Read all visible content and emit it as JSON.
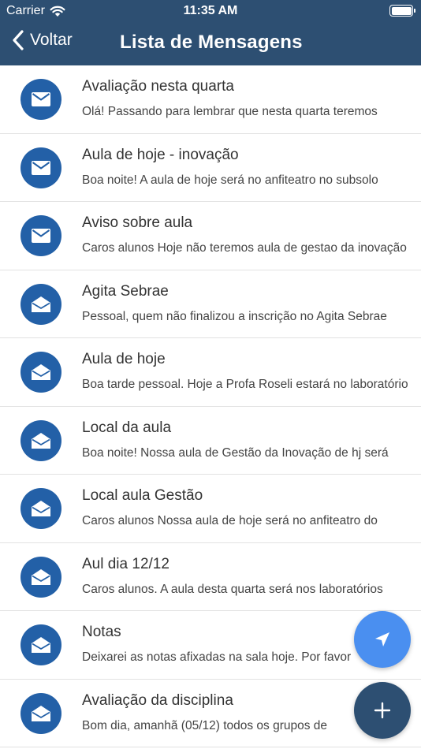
{
  "status_bar": {
    "carrier": "Carrier",
    "time": "11:35 AM"
  },
  "nav": {
    "back_label": "Voltar",
    "title": "Lista de Mensagens"
  },
  "colors": {
    "header": "#2d4f72",
    "avatar": "#2360a7",
    "fab_send": "#4a8ff0",
    "fab_add": "#2d4f72"
  },
  "messages": [
    {
      "title": "Avaliação nesta quarta",
      "preview": "Olá! Passando para lembrar que nesta quarta teremos",
      "icon": "mail-closed-icon"
    },
    {
      "title": "Aula de hoje - inovação",
      "preview": "Boa noite! A aula de hoje será no anfiteatro no subsolo",
      "icon": "mail-closed-icon"
    },
    {
      "title": "Aviso sobre aula",
      "preview": "Caros alunos Hoje não teremos aula de gestao da inovação",
      "icon": "mail-closed-icon"
    },
    {
      "title": "Agita Sebrae",
      "preview": "Pessoal, quem não finalizou a inscrição no Agita Sebrae",
      "icon": "mail-open-icon"
    },
    {
      "title": "Aula de hoje",
      "preview": "Boa tarde pessoal. Hoje a Profa Roseli estará no laboratório",
      "icon": "mail-open-icon"
    },
    {
      "title": "Local da aula",
      "preview": "Boa noite! Nossa aula de Gestão da Inovação de hj será",
      "icon": "mail-open-icon"
    },
    {
      "title": "Local aula Gestão",
      "preview": "Caros alunos Nossa aula de hoje será no anfiteatro do",
      "icon": "mail-open-icon"
    },
    {
      "title": "Aul dia 12/12",
      "preview": "Caros alunos. A aula desta quarta será nos laboratórios",
      "icon": "mail-open-icon"
    },
    {
      "title": "Notas",
      "preview": "Deixarei as notas afixadas na sala hoje. Por favor",
      "icon": "mail-open-icon"
    },
    {
      "title": "Avaliação da disciplina",
      "preview": "Bom dia, amanhã (05/12) todos os grupos de",
      "icon": "mail-open-icon"
    }
  ]
}
